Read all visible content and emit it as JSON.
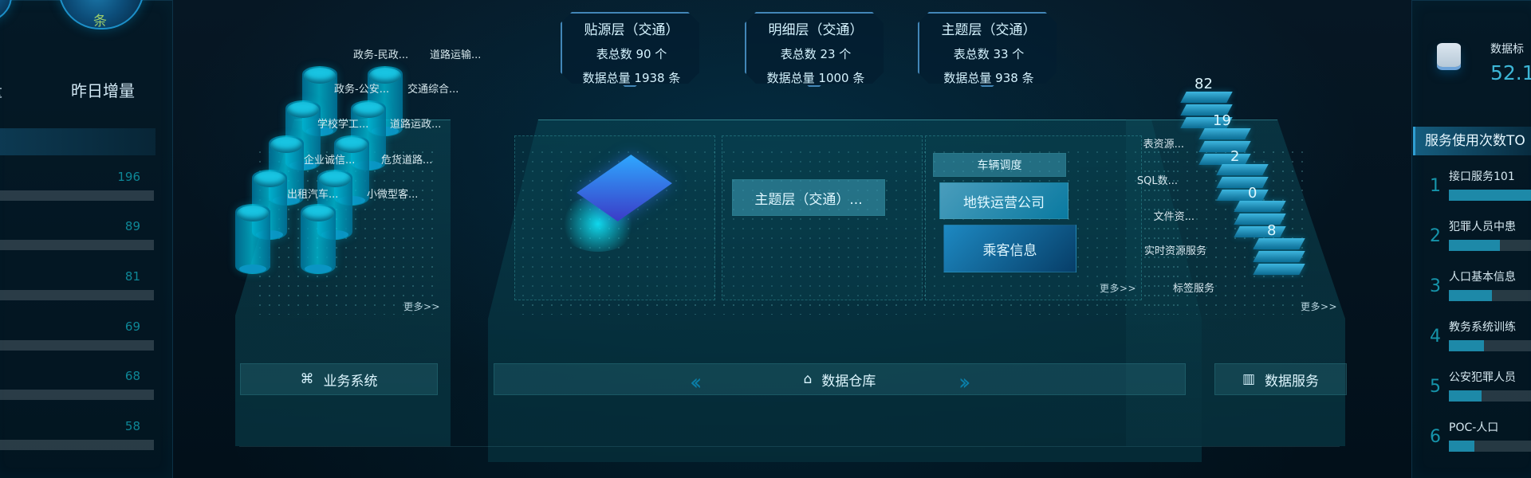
{
  "left": {
    "unit": "条",
    "metric_labels": [
      "量",
      "昨日增量"
    ],
    "bar_values": [
      "196",
      "89",
      "81",
      "69",
      "68",
      "58"
    ]
  },
  "top_cards": [
    {
      "title": "贴源层（交通）",
      "line1": "表总数 90 个",
      "line2": "数据总量 1938 条"
    },
    {
      "title": "明细层（交通）",
      "line1": "表总数 23 个",
      "line2": "数据总量 1000 条"
    },
    {
      "title": "主题层（交通）",
      "line1": "表总数 33 个",
      "line2": "数据总量 938 条"
    }
  ],
  "business": {
    "labels": [
      "政务-民政...",
      "道路运输...",
      "政务-公安...",
      "交通综合...",
      "学校学工...",
      "道路运政...",
      "企业诚信...",
      "危货道路...",
      "出租汽车...",
      "小微型客..."
    ],
    "more": "更多>>",
    "footer": "业务系统"
  },
  "warehouse": {
    "subject_layer": "主题层（交通）...",
    "cards": [
      "车辆调度",
      "地铁运营公司",
      "乘客信息"
    ],
    "more": "更多>>",
    "footer": "数据仓库"
  },
  "service": {
    "stack_counts": [
      "82",
      "19",
      "2",
      "0",
      "8"
    ],
    "labels": [
      "表资源...",
      "SQL数...",
      "文件资...",
      "实时资源服务",
      "标签服务"
    ],
    "more": "更多>>",
    "footer": "数据服务"
  },
  "right": {
    "db_label": "数据标",
    "db_value": "52.1",
    "top10_title": "服务使用次数TO",
    "top10": [
      {
        "rank": "1",
        "name": "接口服务101",
        "fill": 0.86
      },
      {
        "rank": "2",
        "name": "犯罪人员中患",
        "fill": 0.53
      },
      {
        "rank": "3",
        "name": "人口基本信息",
        "fill": 0.45
      },
      {
        "rank": "4",
        "name": "教务系统训练",
        "fill": 0.37
      },
      {
        "rank": "5",
        "name": "公安犯罪人员",
        "fill": 0.34
      },
      {
        "rank": "6",
        "name": "POC-人口",
        "fill": 0.27
      }
    ]
  },
  "colors": {
    "accent": "#1d89a8",
    "title_text": "#d6f4ff",
    "background": "#03111c"
  }
}
